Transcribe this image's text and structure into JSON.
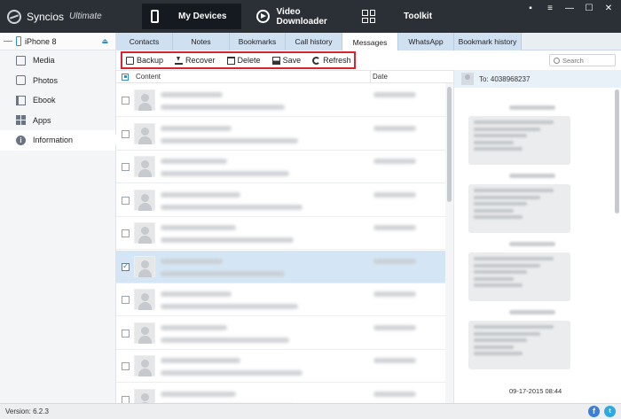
{
  "app": {
    "name": "Syncios",
    "edition": "Ultimate"
  },
  "topnav": {
    "devices": "My Devices",
    "downloader": "Video Downloader",
    "toolkit": "Toolkit"
  },
  "window_controls": {
    "message_glyph": "▪",
    "menu_glyph": "≡",
    "minimize_glyph": "—",
    "maximize_glyph": "☐",
    "close_glyph": "✕"
  },
  "device": {
    "name": "iPhone 8",
    "collapse_glyph": "—",
    "eject_glyph": "⏏"
  },
  "sidebar": {
    "items": [
      {
        "label": "Media",
        "icon": "media-icon"
      },
      {
        "label": "Photos",
        "icon": "photos-icon"
      },
      {
        "label": "Ebook",
        "icon": "ebook-icon"
      },
      {
        "label": "Apps",
        "icon": "apps-icon"
      },
      {
        "label": "Information",
        "icon": "information-icon",
        "active": true
      }
    ]
  },
  "tabs": [
    {
      "label": "Contacts"
    },
    {
      "label": "Notes"
    },
    {
      "label": "Bookmarks"
    },
    {
      "label": "Call history"
    },
    {
      "label": "Messages",
      "active": true
    },
    {
      "label": "WhatsApp"
    },
    {
      "label": "Bookmark history"
    }
  ],
  "toolbar": {
    "backup": "Backup",
    "recover": "Recover",
    "delete": "Delete",
    "save": "Save",
    "refresh": "Refresh",
    "highlight_color": "#d8242e"
  },
  "search": {
    "placeholder": "Search"
  },
  "list": {
    "headers": {
      "content": "Content",
      "date": "Date"
    },
    "selected_row": 5,
    "selection_color": "#d4e6f5"
  },
  "conversation": {
    "to_label": "To: 4038968237",
    "last_date": "09-17-2015 08:44"
  },
  "status": {
    "version": "Version: 6.2.3"
  },
  "social": {
    "facebook": "f",
    "twitter": "t"
  },
  "colors": {
    "titlebar": "#2b3037",
    "accent": "#2c8fd0",
    "tab_bg": "#cfe0f0"
  }
}
